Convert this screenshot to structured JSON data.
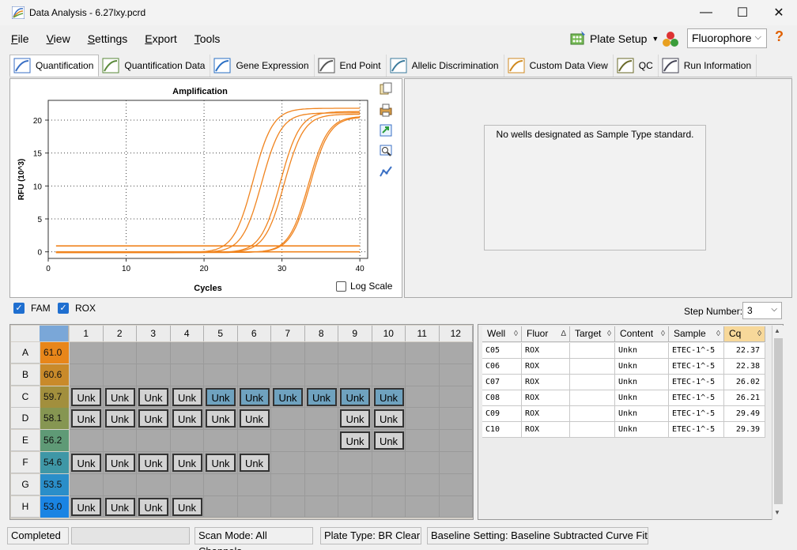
{
  "window": {
    "title": "Data Analysis - 6.27lxy.pcrd",
    "minimize": "—",
    "maximize": "☐",
    "close": "✕"
  },
  "menu": [
    "File",
    "View",
    "Settings",
    "Export",
    "Tools"
  ],
  "menu_access_keys": [
    "F",
    "V",
    "S",
    "E",
    "T"
  ],
  "toolbar": {
    "plate_setup": "Plate Setup",
    "fluorophore": "Fluorophore",
    "help": "?"
  },
  "tabs": [
    {
      "label": "Quantification",
      "icon": "amplification-icon",
      "active": true
    },
    {
      "label": "Quantification Data",
      "icon": "quant-data-icon"
    },
    {
      "label": "Gene Expression",
      "icon": "bar-chart-icon"
    },
    {
      "label": "End Point",
      "icon": "end-point-icon"
    },
    {
      "label": "Allelic Discrimination",
      "icon": "allelic-icon"
    },
    {
      "label": "Custom Data View",
      "icon": "custom-view-icon"
    },
    {
      "label": "QC",
      "icon": "qc-icon"
    },
    {
      "label": "Run Information",
      "icon": "run-info-icon"
    }
  ],
  "chart_data": {
    "type": "line",
    "title": "Amplification",
    "xlabel": "Cycles",
    "ylabel": "RFU (10^3)",
    "xlim": [
      0,
      41
    ],
    "ylim": [
      -1,
      23
    ],
    "xticks": [
      0,
      10,
      20,
      30,
      40
    ],
    "yticks": [
      0,
      5,
      10,
      15,
      20
    ],
    "grid": true,
    "color": "#f0841f",
    "log_scale_label": "Log Scale",
    "series": [
      {
        "midpoint": 26.3,
        "plateau": 21.9
      },
      {
        "midpoint": 27.4,
        "plateau": 21.2
      },
      {
        "midpoint": 29.8,
        "plateau": 21.4
      },
      {
        "midpoint": 30.3,
        "plateau": 21.0
      },
      {
        "midpoint": 33.4,
        "plateau": 20.7
      },
      {
        "midpoint": 33.6,
        "plateau": 20.6
      }
    ],
    "flat_lines": [
      0.9,
      0.0
    ]
  },
  "standards_message": "No wells designated as Sample Type standard.",
  "filters": {
    "fam": "FAM",
    "rox": "ROX",
    "step_label": "Step Number:",
    "step_value": "3"
  },
  "plate": {
    "columns": [
      "1",
      "2",
      "3",
      "4",
      "5",
      "6",
      "7",
      "8",
      "9",
      "10",
      "11",
      "12"
    ],
    "rows": [
      {
        "label": "A",
        "temp": "61.0",
        "color": "#e8861a",
        "wells": []
      },
      {
        "label": "B",
        "temp": "60.6",
        "color": "#c98a2a",
        "wells": []
      },
      {
        "label": "C",
        "temp": "59.7",
        "color": "#a28f3d",
        "wells": [
          1,
          2,
          3,
          4,
          5,
          6,
          7,
          8,
          9,
          10
        ],
        "selected": [
          5,
          6,
          7,
          8,
          9,
          10
        ]
      },
      {
        "label": "D",
        "temp": "58.1",
        "color": "#869652",
        "wells": [
          1,
          2,
          3,
          4,
          5,
          6,
          9,
          10
        ],
        "selected": []
      },
      {
        "label": "E",
        "temp": "56.2",
        "color": "#5f9a76",
        "wells": [
          9,
          10
        ],
        "selected": []
      },
      {
        "label": "F",
        "temp": "54.6",
        "color": "#3f97a6",
        "wells": [
          1,
          2,
          3,
          4,
          5,
          6
        ],
        "selected": []
      },
      {
        "label": "G",
        "temp": "53.5",
        "color": "#2a8ec9",
        "wells": []
      },
      {
        "label": "H",
        "temp": "53.0",
        "color": "#1a84e3",
        "wells": [
          1,
          2,
          3,
          4
        ],
        "selected": []
      }
    ],
    "well_label": "Unk"
  },
  "table": {
    "headers": [
      "Well",
      "Fluor",
      "Target",
      "Content",
      "Sample",
      "Cq"
    ],
    "rows": [
      [
        "C05",
        "ROX",
        "",
        "Unkn",
        "ETEC-1^-5",
        "22.37"
      ],
      [
        "C06",
        "ROX",
        "",
        "Unkn",
        "ETEC-1^-5",
        "22.38"
      ],
      [
        "C07",
        "ROX",
        "",
        "Unkn",
        "ETEC-1^-5",
        "26.02"
      ],
      [
        "C08",
        "ROX",
        "",
        "Unkn",
        "ETEC-1^-5",
        "26.21"
      ],
      [
        "C09",
        "ROX",
        "",
        "Unkn",
        "ETEC-1^-5",
        "29.49"
      ],
      [
        "C10",
        "ROX",
        "",
        "Unkn",
        "ETEC-1^-5",
        "29.39"
      ]
    ]
  },
  "status": {
    "state": "Completed",
    "scan_mode": "Scan Mode: All Channels",
    "plate_type": "Plate Type: BR Clear",
    "baseline": "Baseline Setting: Baseline Subtracted Curve Fit"
  }
}
